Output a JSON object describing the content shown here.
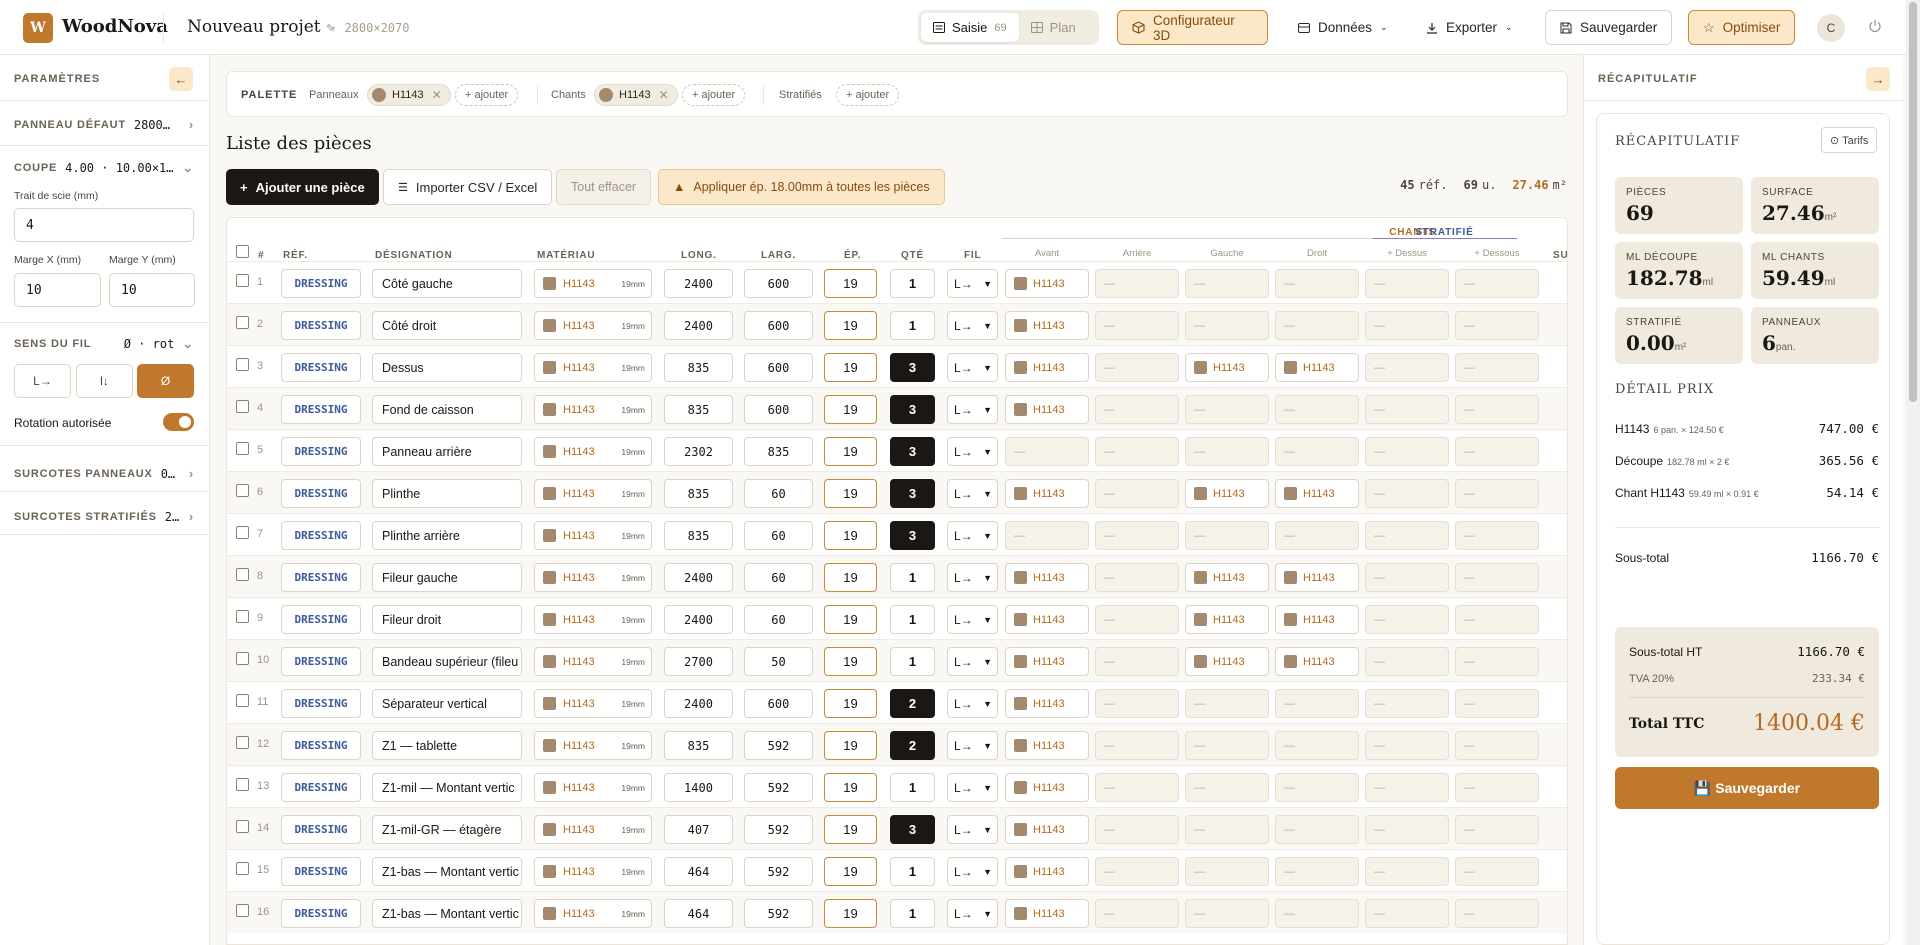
{
  "app": {
    "logo_letter": "W",
    "name": "WoodNova"
  },
  "project": {
    "name": "Nouveau projet",
    "size": "2800×2070"
  },
  "view_toggle": {
    "saisie": "Saisie",
    "saisie_count": "69",
    "plan": "Plan"
  },
  "toolbar": {
    "configurator": "Configurateur 3D",
    "data": "Données",
    "export": "Exporter",
    "save": "Sauvegarder",
    "optimize": "Optimiser",
    "avatar": "C"
  },
  "params": {
    "title": "PARAMÈTRES",
    "default_panel_label": "PANNEAU DÉFAUT",
    "default_panel_value": "2800…",
    "cut_label": "COUPE",
    "cut_value": "4.00 · 10.00×1…",
    "saw_label": "Trait de scie (mm)",
    "saw_value": "4",
    "margin_x_label": "Marge X (mm)",
    "margin_x_value": "10",
    "margin_y_label": "Marge Y (mm)",
    "margin_y_value": "10",
    "grain_label": "SENS DU FIL",
    "grain_value": "Ø · rot",
    "grain_opt_1": "L→",
    "grain_opt_2": "l↓",
    "grain_opt_3": "Ø",
    "rotation_label": "Rotation autorisée",
    "panel_surcharges_label": "SURCOTES PANNEAUX",
    "panel_surcharges_value": "0…",
    "lam_surcharges_label": "SURCOTES STRATIFIÉS",
    "lam_surcharges_value": "2…"
  },
  "palette": {
    "title": "PALETTE",
    "panels_label": "Panneaux",
    "panels_chip": "H1143",
    "edges_label": "Chants",
    "edges_chip": "H1143",
    "laminates_label": "Stratifiés",
    "add": "+ ajouter"
  },
  "list": {
    "title": "Liste des pièces",
    "add_piece": "Ajouter une pièce",
    "import": "Importer CSV / Excel",
    "clear": "Tout effacer",
    "apply_thickness": "Appliquer ép. 18.00mm à toutes les pièces",
    "refs_count": "45",
    "refs_unit": "réf.",
    "units_count": "69",
    "units_unit": "u.",
    "area": "27.46",
    "area_unit": "m²"
  },
  "table": {
    "headers": {
      "num": "#",
      "ref": "RÉF.",
      "designation": "DÉSIGNATION",
      "material": "MATÉRIAU",
      "length": "LONG.",
      "width": "LARG.",
      "thickness": "ÉP.",
      "qty": "QTÉ",
      "grain": "FIL",
      "edges": "CHANTS",
      "laminate": "STRATIFIÉ",
      "surcharge": "SUR"
    },
    "subheaders": {
      "front": "Avant",
      "back": "Arrière",
      "left": "Gauche",
      "right": "Droit",
      "top": "+ Dessus",
      "bottom": "+ Dessous"
    },
    "empty": "—",
    "material_thickness": "19mm",
    "rows": [
      {
        "n": "1",
        "ref": "DRESSING",
        "des": "Côté gauche",
        "mat": "H1143",
        "len": "2400",
        "wid": "600",
        "ep": "19",
        "qty": "1",
        "fil": "L→",
        "av": "H1143",
        "ar": "",
        "ga": "",
        "dr": ""
      },
      {
        "n": "2",
        "ref": "DRESSING",
        "des": "Côté droit",
        "mat": "H1143",
        "len": "2400",
        "wid": "600",
        "ep": "19",
        "qty": "1",
        "fil": "L→",
        "av": "H1143",
        "ar": "",
        "ga": "",
        "dr": ""
      },
      {
        "n": "3",
        "ref": "DRESSING",
        "des": "Dessus",
        "mat": "H1143",
        "len": "835",
        "wid": "600",
        "ep": "19",
        "qty": "3",
        "fil": "L→",
        "av": "H1143",
        "ar": "",
        "ga": "H1143",
        "dr": "H1143"
      },
      {
        "n": "4",
        "ref": "DRESSING",
        "des": "Fond de caisson",
        "mat": "H1143",
        "len": "835",
        "wid": "600",
        "ep": "19",
        "qty": "3",
        "fil": "L→",
        "av": "H1143",
        "ar": "",
        "ga": "",
        "dr": ""
      },
      {
        "n": "5",
        "ref": "DRESSING",
        "des": "Panneau arrière",
        "mat": "H1143",
        "len": "2302",
        "wid": "835",
        "ep": "19",
        "qty": "3",
        "fil": "L→",
        "av": "",
        "ar": "",
        "ga": "",
        "dr": ""
      },
      {
        "n": "6",
        "ref": "DRESSING",
        "des": "Plinthe",
        "mat": "H1143",
        "len": "835",
        "wid": "60",
        "ep": "19",
        "qty": "3",
        "fil": "L→",
        "av": "H1143",
        "ar": "",
        "ga": "H1143",
        "dr": "H1143"
      },
      {
        "n": "7",
        "ref": "DRESSING",
        "des": "Plinthe arrière",
        "mat": "H1143",
        "len": "835",
        "wid": "60",
        "ep": "19",
        "qty": "3",
        "fil": "L→",
        "av": "",
        "ar": "",
        "ga": "",
        "dr": ""
      },
      {
        "n": "8",
        "ref": "DRESSING",
        "des": "Fileur gauche",
        "mat": "H1143",
        "len": "2400",
        "wid": "60",
        "ep": "19",
        "qty": "1",
        "fil": "L→",
        "av": "H1143",
        "ar": "",
        "ga": "H1143",
        "dr": "H1143"
      },
      {
        "n": "9",
        "ref": "DRESSING",
        "des": "Fileur droit",
        "mat": "H1143",
        "len": "2400",
        "wid": "60",
        "ep": "19",
        "qty": "1",
        "fil": "L→",
        "av": "H1143",
        "ar": "",
        "ga": "H1143",
        "dr": "H1143"
      },
      {
        "n": "10",
        "ref": "DRESSING",
        "des": "Bandeau supérieur (fileu",
        "mat": "H1143",
        "len": "2700",
        "wid": "50",
        "ep": "19",
        "qty": "1",
        "fil": "L→",
        "av": "H1143",
        "ar": "",
        "ga": "H1143",
        "dr": "H1143"
      },
      {
        "n": "11",
        "ref": "DRESSING",
        "des": "Séparateur vertical",
        "mat": "H1143",
        "len": "2400",
        "wid": "600",
        "ep": "19",
        "qty": "2",
        "fil": "L→",
        "av": "H1143",
        "ar": "",
        "ga": "",
        "dr": ""
      },
      {
        "n": "12",
        "ref": "DRESSING",
        "des": "Z1 — tablette",
        "mat": "H1143",
        "len": "835",
        "wid": "592",
        "ep": "19",
        "qty": "2",
        "fil": "L→",
        "av": "H1143",
        "ar": "",
        "ga": "",
        "dr": ""
      },
      {
        "n": "13",
        "ref": "DRESSING",
        "des": "Z1-mil — Montant vertic",
        "mat": "H1143",
        "len": "1400",
        "wid": "592",
        "ep": "19",
        "qty": "1",
        "fil": "L→",
        "av": "H1143",
        "ar": "",
        "ga": "",
        "dr": ""
      },
      {
        "n": "14",
        "ref": "DRESSING",
        "des": "Z1-mil-GR — étagère",
        "mat": "H1143",
        "len": "407",
        "wid": "592",
        "ep": "19",
        "qty": "3",
        "fil": "L→",
        "av": "H1143",
        "ar": "",
        "ga": "",
        "dr": ""
      },
      {
        "n": "15",
        "ref": "DRESSING",
        "des": "Z1-bas — Montant vertic",
        "mat": "H1143",
        "len": "464",
        "wid": "592",
        "ep": "19",
        "qty": "1",
        "fil": "L→",
        "av": "H1143",
        "ar": "",
        "ga": "",
        "dr": ""
      },
      {
        "n": "16",
        "ref": "DRESSING",
        "des": "Z1-bas — Montant vertic",
        "mat": "H1143",
        "len": "464",
        "wid": "592",
        "ep": "19",
        "qty": "1",
        "fil": "L→",
        "av": "H1143",
        "ar": "",
        "ga": "",
        "dr": ""
      }
    ]
  },
  "recap": {
    "panel_title": "RÉCAPITULATIF",
    "card_title": "RÉCAPITULATIF",
    "tarifs": "⊙ Tarifs",
    "stats": [
      {
        "label": "PIÈCES",
        "value": "69",
        "unit": ""
      },
      {
        "label": "SURFACE",
        "value": "27.46",
        "unit": "m²"
      },
      {
        "label": "ML DÉCOUPE",
        "value": "182.78",
        "unit": "ml"
      },
      {
        "label": "ML CHANTS",
        "value": "59.49",
        "unit": "ml"
      },
      {
        "label": "STRATIFIÉ",
        "value": "0.00",
        "unit": "m²"
      },
      {
        "label": "PANNEAUX",
        "value": "6",
        "unit": "pan."
      }
    ],
    "detail_title": "DÉTAIL PRIX",
    "lines": [
      {
        "name": "H1143",
        "detail": "6 pan. × 124.50 €",
        "amount": "747.00 €"
      },
      {
        "name": "Découpe",
        "detail": "182.78 ml × 2 €",
        "amount": "365.56 €"
      },
      {
        "name": "Chant H1143",
        "detail": "59.49 ml × 0.91 €",
        "amount": "54.14 €"
      }
    ],
    "subtotal_label": "Sous-total",
    "subtotal": "1166.70 €",
    "subtotal_ht_label": "Sous-total HT",
    "subtotal_ht": "1166.70 €",
    "tva_label": "TVA 20%",
    "tva": "233.34 €",
    "ttc_label": "Total TTC",
    "ttc": "1400.04 €",
    "save": "💾 Sauvegarder"
  },
  "colors": {
    "accent": "#c0782d",
    "ref_blue": "#3b5b9a",
    "dark": "#1a1714"
  }
}
